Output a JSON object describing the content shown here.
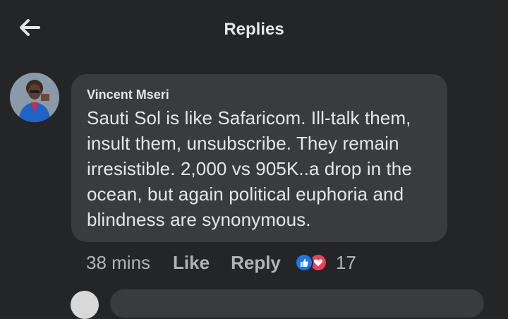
{
  "header": {
    "back_icon": "arrow-left-icon",
    "title": "Replies"
  },
  "comment": {
    "author": "Vincent Mseri",
    "lines": [
      "Sauti Sol is like Safaricom. Ill-talk them,",
      "insult them, unsubscribe. They remain",
      "irresistible. 2,000 vs 905K..a drop in the",
      "ocean, but again political euphoria and",
      "blindness are synonymous."
    ],
    "time": "38 mins",
    "like_label": "Like",
    "reply_label": "Reply",
    "reactions": {
      "icons": [
        "like-reaction-icon",
        "love-reaction-icon"
      ],
      "count": "17"
    }
  },
  "colors": {
    "background": "#242526",
    "bubble": "#3a3b3c",
    "text": "#e4e6eb",
    "secondary_text": "#b0b3b8",
    "like_blue": "#1877f2",
    "love_red": "#f33e58"
  }
}
